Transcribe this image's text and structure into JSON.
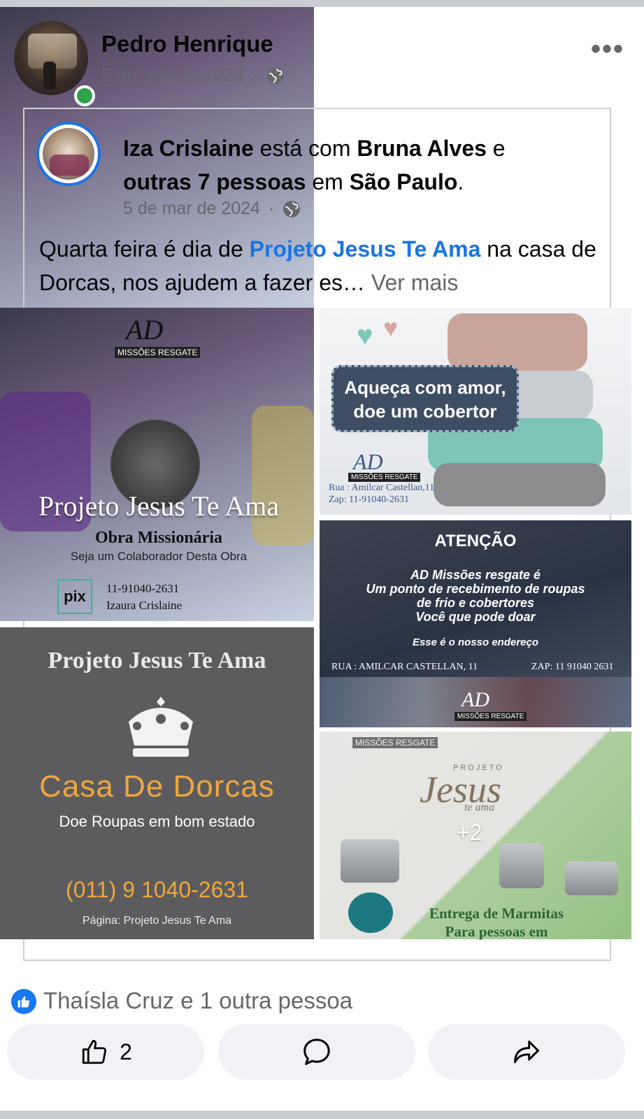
{
  "post": {
    "author": "Pedro Henrique",
    "date": "5 de mar de 2024",
    "separator": "·",
    "privacy_icon": "globe-icon",
    "online_color": "#31a24c"
  },
  "shared": {
    "author": "Iza Crislaine",
    "with_text": "está com",
    "with_person": "Bruna Alves",
    "and_text": "e",
    "others": "outras 7 pessoas",
    "in_text": "em",
    "place": "São Paulo",
    "period": ".",
    "date": "5 de mar de 2024",
    "text_before": "Quarta feira é dia de",
    "link_text": "Projeto Jesus Te Ama",
    "text_after": "na casa de Dorcas, nos ajudem a fazer es…",
    "see_more": "Ver mais"
  },
  "images": {
    "img1": {
      "brand": "AD",
      "brand_sub": "MISSÕES RESGATE",
      "title": "Projeto Jesus Te Ama",
      "subtitle": "Obra Missionária",
      "tagline": "Seja um Colaborador Desta Obra",
      "pix": "pix",
      "phone": "11-91040-2631",
      "name": "Izaura Crislaine"
    },
    "img2": {
      "headline_1": "Aqueça com amor,",
      "headline_2": "doe um cobertor",
      "brand": "AD",
      "brand_sub": "MISSÕES RESGATE",
      "address": "Rua : Amilcar Castellan,11",
      "zap": "Zap: 11-91040-2631"
    },
    "img3": {
      "attention": "ATENÇÃO",
      "line1": "AD Missões resgate é",
      "line2": "Um ponto de recebimento de roupas",
      "line3": "de frio e cobertores",
      "line4": "Você que pode doar",
      "address_intro": "Esse é o nosso endereço",
      "rua": "RUA : AMILCAR CASTELLAN, 11",
      "zap": "ZAP: 11 91040 2631",
      "brand": "AD",
      "brand_sub": "MISSÕES RESGATE"
    },
    "img4": {
      "title": "Projeto Jesus Te Ama",
      "casa": "Casa De Dorcas",
      "doe": "Doe Roupas em bom estado",
      "phone": "(011) 9 1040-2631",
      "page": "Página: Projeto Jesus Te Ama"
    },
    "img5": {
      "brand_sub": "MISSÕES RESGATE",
      "projeto": "PROJETO",
      "jesus": "Jesus",
      "te_ama": "te ama",
      "entrega": "Entrega de Marmitas",
      "para": "Para pessoas em",
      "more_count": "+2"
    }
  },
  "reactions": {
    "text": "Thaísla Cruz e 1 outra pessoa",
    "like_color": "#1877f2"
  },
  "actions": {
    "like_count": "2",
    "like_icon": "thumbs-up-icon",
    "comment_icon": "comment-icon",
    "share_icon": "share-icon"
  }
}
